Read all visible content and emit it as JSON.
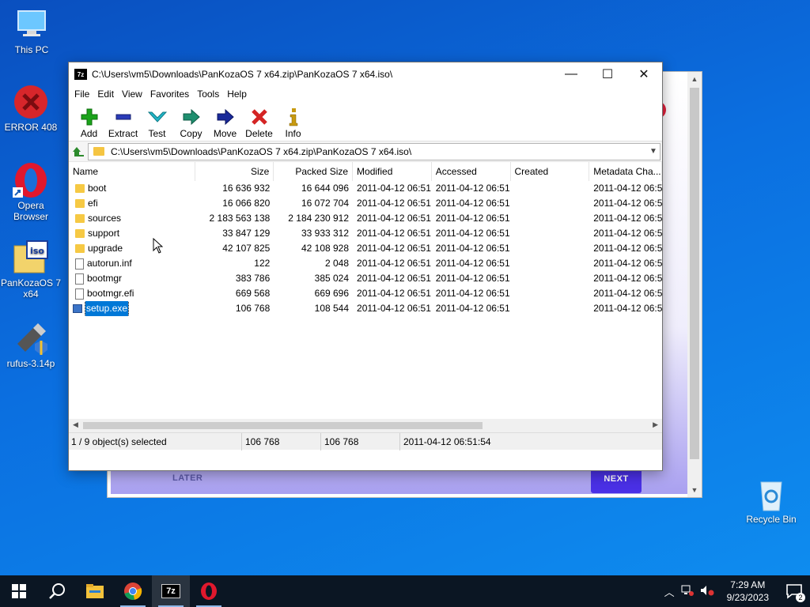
{
  "desktop": {
    "icons": [
      {
        "label": "This PC"
      },
      {
        "label": "ERROR 408"
      },
      {
        "label": "Opera Browser"
      },
      {
        "label": "PanKozaOS 7 x64"
      },
      {
        "label": "rufus-3.14p"
      },
      {
        "label": "Recycle Bin"
      }
    ]
  },
  "background_window": {
    "later_label": "LATER",
    "next_label": "NEXT"
  },
  "window": {
    "title": "C:\\Users\\vm5\\Downloads\\PanKozaOS 7 x64.zip\\PanKozaOS 7 x64.iso\\",
    "app_icon_text": "7z",
    "controls": {
      "minimize": "—",
      "maximize": "☐",
      "close": "✕"
    },
    "menu": [
      "File",
      "Edit",
      "View",
      "Favorites",
      "Tools",
      "Help"
    ],
    "toolbar": [
      {
        "label": "Add",
        "icon": "plus-icon",
        "color": "#1aa31a"
      },
      {
        "label": "Extract",
        "icon": "minus-icon",
        "color": "#2a3bb8"
      },
      {
        "label": "Test",
        "icon": "check-icon",
        "color": "#22b7c8"
      },
      {
        "label": "Copy",
        "icon": "double-arrow-icon",
        "color": "#1f8f6f"
      },
      {
        "label": "Move",
        "icon": "arrow-right-icon",
        "color": "#1a2a9a"
      },
      {
        "label": "Delete",
        "icon": "x-icon",
        "color": "#d42424"
      },
      {
        "label": "Info",
        "icon": "info-icon",
        "color": "#c89a10"
      }
    ],
    "address": "C:\\Users\\vm5\\Downloads\\PanKozaOS 7 x64.zip\\PanKozaOS 7 x64.iso\\",
    "columns": [
      "Name",
      "Size",
      "Packed Size",
      "Modified",
      "Accessed",
      "Created",
      "Metadata Cha..."
    ],
    "rows": [
      {
        "name": "boot",
        "type": "folder",
        "size": "16 636 932",
        "packed": "16 644 096",
        "modified": "2011-04-12 06:51",
        "accessed": "2011-04-12 06:51",
        "created": "",
        "meta": "2011-04-12 06:5"
      },
      {
        "name": "efi",
        "type": "folder",
        "size": "16 066 820",
        "packed": "16 072 704",
        "modified": "2011-04-12 06:51",
        "accessed": "2011-04-12 06:51",
        "created": "",
        "meta": "2011-04-12 06:5"
      },
      {
        "name": "sources",
        "type": "folder",
        "size": "2 183 563 138",
        "packed": "2 184 230 912",
        "modified": "2011-04-12 06:51",
        "accessed": "2011-04-12 06:51",
        "created": "",
        "meta": "2011-04-12 06:5"
      },
      {
        "name": "support",
        "type": "folder",
        "size": "33 847 129",
        "packed": "33 933 312",
        "modified": "2011-04-12 06:51",
        "accessed": "2011-04-12 06:51",
        "created": "",
        "meta": "2011-04-12 06:5"
      },
      {
        "name": "upgrade",
        "type": "folder",
        "size": "42 107 825",
        "packed": "42 108 928",
        "modified": "2011-04-12 06:51",
        "accessed": "2011-04-12 06:51",
        "created": "",
        "meta": "2011-04-12 06:5"
      },
      {
        "name": "autorun.inf",
        "type": "file",
        "size": "122",
        "packed": "2 048",
        "modified": "2011-04-12 06:51",
        "accessed": "2011-04-12 06:51",
        "created": "",
        "meta": "2011-04-12 06:5"
      },
      {
        "name": "bootmgr",
        "type": "file",
        "size": "383 786",
        "packed": "385 024",
        "modified": "2011-04-12 06:51",
        "accessed": "2011-04-12 06:51",
        "created": "",
        "meta": "2011-04-12 06:5"
      },
      {
        "name": "bootmgr.efi",
        "type": "file",
        "size": "669 568",
        "packed": "669 696",
        "modified": "2011-04-12 06:51",
        "accessed": "2011-04-12 06:51",
        "created": "",
        "meta": "2011-04-12 06:5"
      },
      {
        "name": "setup.exe",
        "type": "exe",
        "size": "106 768",
        "packed": "108 544",
        "modified": "2011-04-12 06:51",
        "accessed": "2011-04-12 06:51",
        "created": "",
        "meta": "2011-04-12 06:5",
        "selected": true
      }
    ],
    "status": {
      "selection": "1 / 9 object(s) selected",
      "size": "106 768",
      "packed": "106 768",
      "date": "2011-04-12 06:51:54"
    }
  },
  "taskbar": {
    "apps": [
      "start-icon",
      "search-icon",
      "file-explorer-icon",
      "chrome-icon",
      "7zip-icon",
      "opera-icon"
    ],
    "time": "7:29 AM",
    "date": "9/23/2023",
    "notification_count": "2"
  }
}
